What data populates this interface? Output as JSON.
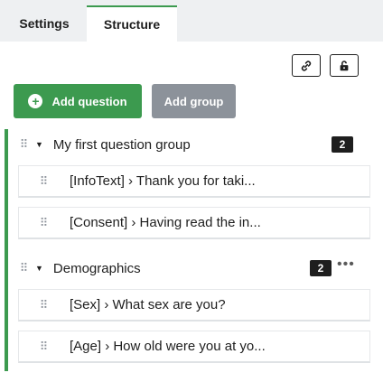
{
  "tabs": {
    "settings": "Settings",
    "structure": "Structure"
  },
  "toolbar": {
    "link_icon": "link-icon",
    "lock_icon": "unlock-icon",
    "add_question": "Add question",
    "add_group": "Add group"
  },
  "groups": [
    {
      "title": "My first question group",
      "count": "2",
      "questions": [
        "[InfoText] › Thank you for taki...",
        "[Consent] › Having read the in..."
      ]
    },
    {
      "title": "Demographics",
      "count": "2",
      "more": "•••",
      "questions": [
        "[Sex] › What sex are you?",
        "[Age] › How old were you at yo..."
      ]
    }
  ],
  "glyphs": {
    "drag": "⠿",
    "caret": "▼",
    "plus": "+"
  },
  "colors": {
    "accent": "#3c9a4f",
    "muted_button": "#8c929a",
    "badge": "#1e1e1e"
  }
}
